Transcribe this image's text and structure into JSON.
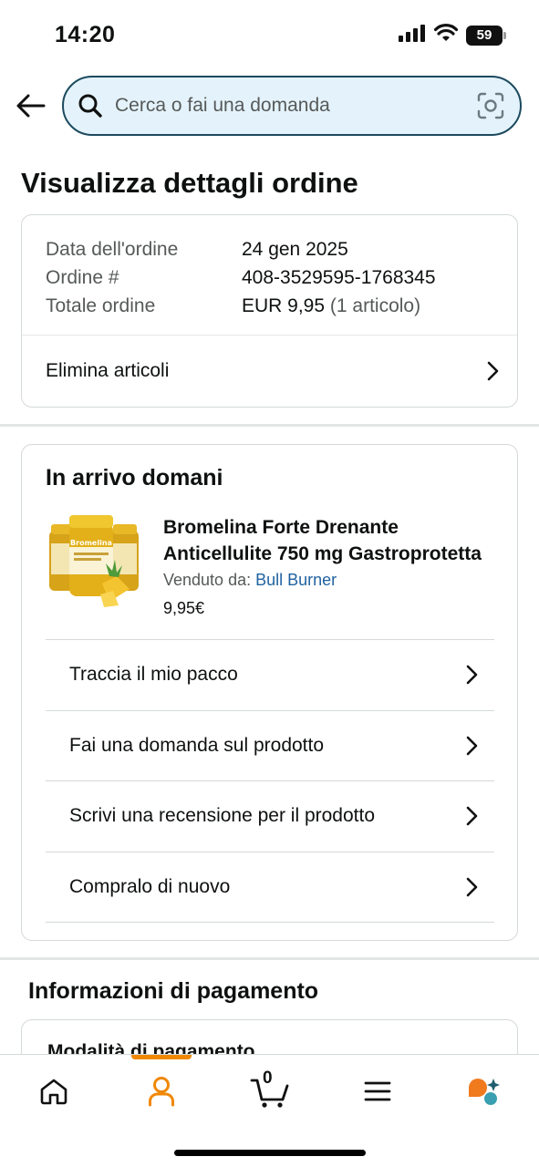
{
  "status_bar": {
    "time": "14:20",
    "battery": "59"
  },
  "search": {
    "placeholder": "Cerca o fai una domanda"
  },
  "page_title": "Visualizza dettagli ordine",
  "order_summary": {
    "rows": [
      {
        "label": "Data dell'ordine",
        "value": "24 gen 2025"
      },
      {
        "label": "Ordine #",
        "value": "408-3529595-1768345"
      }
    ],
    "total_label": "Totale ordine",
    "total_value": "EUR 9,95",
    "total_count": "(1 articolo)",
    "delete_items": "Elimina articoli"
  },
  "shipment": {
    "heading": "In arrivo domani",
    "product": {
      "title_line1": "Bromelina Forte Drenante",
      "title_line2": "Anticellulite 750 mg Gastroprotetta",
      "sold_by_label": "Venduto da:",
      "seller": "Bull Burner",
      "price": "9,95€",
      "thumb_label": "Bromelina"
    },
    "actions": [
      "Traccia il mio pacco",
      "Fai una domanda sul prodotto",
      "Scrivi una recensione per il prodotto",
      "Compralo di nuovo"
    ]
  },
  "payment": {
    "title": "Informazioni di pagamento",
    "method_title": "Modalità di pagamento"
  },
  "bottom_nav": {
    "items": [
      "home-icon",
      "account-icon",
      "cart-icon",
      "menu-icon",
      "rufus-icon"
    ],
    "active": "account-icon",
    "cart_count": "0"
  },
  "colors": {
    "accent_orange": "#f08804",
    "search_border": "#1c4a5e",
    "search_bg": "#e4f3fb",
    "link_blue": "#2162a1"
  }
}
